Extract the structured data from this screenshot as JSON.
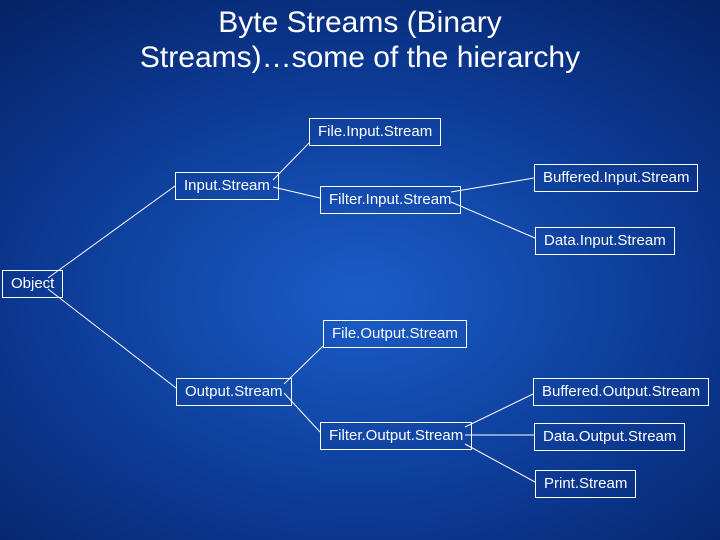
{
  "title_line1": "Byte Streams (Binary",
  "title_line2": "Streams)…some of the hierarchy",
  "nodes": {
    "object": "Object",
    "inputStream": "Input.Stream",
    "fileInputStream": "File.Input.Stream",
    "filterInputStream": "Filter.Input.Stream",
    "bufferedInputStream": "Buffered.Input.Stream",
    "dataInputStream": "Data.Input.Stream",
    "outputStream": "Output.Stream",
    "fileOutputStream": "File.Output.Stream",
    "filterOutputStream": "Filter.Output.Stream",
    "bufferedOutputStream": "Buffered.Output.Stream",
    "dataOutputStream": "Data.Output.Stream",
    "printStream": "Print.Stream"
  }
}
